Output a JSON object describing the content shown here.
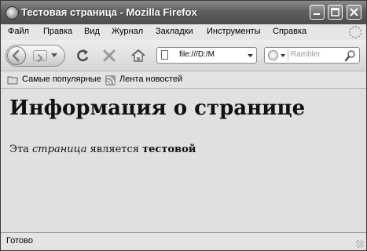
{
  "window": {
    "title": "Тестовая страница - Mozilla Firefox"
  },
  "menu": {
    "items": [
      "Файл",
      "Правка",
      "Вид",
      "Журнал",
      "Закладки",
      "Инструменты",
      "Справка"
    ]
  },
  "navigation": {
    "url": "file:///D:/M",
    "search_placeholder": "Rambler"
  },
  "bookmarks": {
    "items": [
      "Самые популярные",
      "Лента новостей"
    ]
  },
  "page": {
    "heading": "Информация о странице",
    "paragraph": {
      "part1": "Эта ",
      "emphasis": "страница",
      "part2": " является ",
      "strong": "тестовой"
    }
  },
  "status": {
    "text": "Готово"
  }
}
